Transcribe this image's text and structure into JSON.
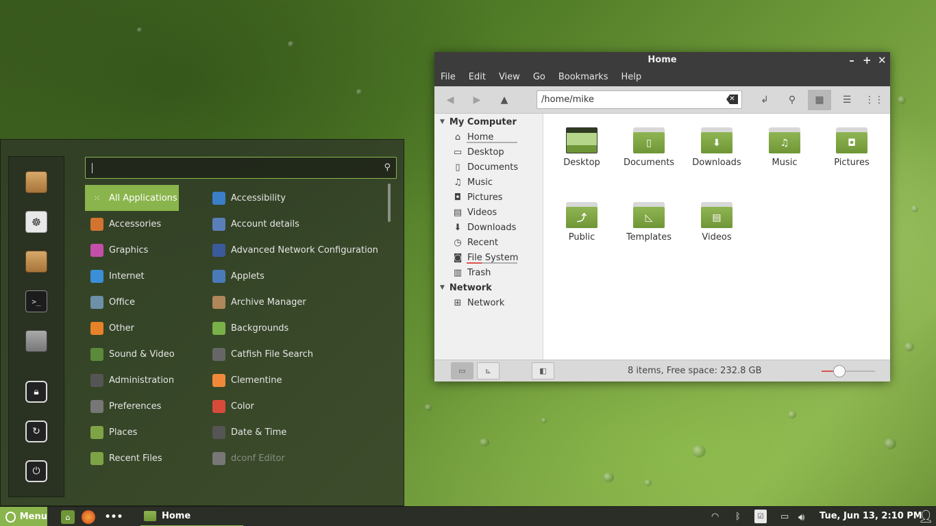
{
  "menu": {
    "categories": [
      {
        "label": "All Applications",
        "icon": "grid-icon",
        "color": "#8ab44c"
      },
      {
        "label": "Accessories",
        "icon": "accessories-icon",
        "color": "#d2742f"
      },
      {
        "label": "Graphics",
        "icon": "graphics-icon",
        "color": "#c44fa8"
      },
      {
        "label": "Internet",
        "icon": "internet-icon",
        "color": "#3a8fd8"
      },
      {
        "label": "Office",
        "icon": "office-icon",
        "color": "#6d8fa8"
      },
      {
        "label": "Other",
        "icon": "other-icon",
        "color": "#e8822a"
      },
      {
        "label": "Sound & Video",
        "icon": "sound-video-icon",
        "color": "#5a8a3a"
      },
      {
        "label": "Administration",
        "icon": "administration-icon",
        "color": "#555555"
      },
      {
        "label": "Preferences",
        "icon": "preferences-icon",
        "color": "#777777"
      },
      {
        "label": "Places",
        "icon": "places-icon",
        "color": "#7ea346"
      },
      {
        "label": "Recent Files",
        "icon": "recent-files-icon",
        "color": "#7ea346"
      }
    ],
    "apps": [
      {
        "label": "Accessibility",
        "icon": "accessibility-icon",
        "color": "#3a7fc8"
      },
      {
        "label": "Account details",
        "icon": "account-details-icon",
        "color": "#5a7fb8"
      },
      {
        "label": "Advanced Network Configuration",
        "icon": "network-config-icon",
        "color": "#3a5a9a"
      },
      {
        "label": "Applets",
        "icon": "applets-icon",
        "color": "#4a7ab8"
      },
      {
        "label": "Archive Manager",
        "icon": "archive-manager-icon",
        "color": "#b0865a"
      },
      {
        "label": "Backgrounds",
        "icon": "backgrounds-icon",
        "color": "#7ab048"
      },
      {
        "label": "Catfish File Search",
        "icon": "catfish-icon",
        "color": "#666666"
      },
      {
        "label": "Clementine",
        "icon": "clementine-icon",
        "color": "#f08a3a"
      },
      {
        "label": "Color",
        "icon": "color-icon",
        "color": "#d84a3a"
      },
      {
        "label": "Date & Time",
        "icon": "date-time-icon",
        "color": "#555555"
      },
      {
        "label": "dconf Editor",
        "icon": "dconf-editor-icon",
        "color": "#777777"
      }
    ],
    "favorites": [
      "package-installer-icon",
      "software-manager-icon",
      "package-manager-icon",
      "terminal-icon",
      "mixer-icon",
      "lock-screen-icon",
      "logout-icon",
      "shutdown-icon"
    ]
  },
  "window": {
    "title": "Home",
    "menubar": [
      "File",
      "Edit",
      "View",
      "Go",
      "Bookmarks",
      "Help"
    ],
    "path": "/home/mike",
    "sidebar": {
      "sections": [
        {
          "title": "My Computer",
          "items": [
            {
              "label": "Home",
              "icon": "home-icon"
            },
            {
              "label": "Desktop",
              "icon": "desktop-icon"
            },
            {
              "label": "Documents",
              "icon": "documents-icon"
            },
            {
              "label": "Music",
              "icon": "music-icon"
            },
            {
              "label": "Pictures",
              "icon": "pictures-icon"
            },
            {
              "label": "Videos",
              "icon": "videos-icon"
            },
            {
              "label": "Downloads",
              "icon": "downloads-icon"
            },
            {
              "label": "Recent",
              "icon": "recent-icon"
            },
            {
              "label": "File System",
              "icon": "filesystem-icon"
            },
            {
              "label": "Trash",
              "icon": "trash-icon"
            }
          ]
        },
        {
          "title": "Network",
          "items": [
            {
              "label": "Network",
              "icon": "network-icon"
            }
          ]
        }
      ]
    },
    "files": [
      {
        "label": "Desktop",
        "icon": "desktop-folder-icon",
        "glyph": ""
      },
      {
        "label": "Documents",
        "icon": "documents-folder-icon",
        "glyph": "▯"
      },
      {
        "label": "Downloads",
        "icon": "downloads-folder-icon",
        "glyph": "⬇"
      },
      {
        "label": "Music",
        "icon": "music-folder-icon",
        "glyph": "♫"
      },
      {
        "label": "Pictures",
        "icon": "pictures-folder-icon",
        "glyph": "◘"
      },
      {
        "label": "Public",
        "icon": "public-folder-icon",
        "glyph": "⤴"
      },
      {
        "label": "Templates",
        "icon": "templates-folder-icon",
        "glyph": "◺"
      },
      {
        "label": "Videos",
        "icon": "videos-folder-icon",
        "glyph": "▤"
      }
    ],
    "status": "8 items, Free space: 232.8 GB"
  },
  "taskbar": {
    "menu_label": "Menu",
    "task_label": "Home",
    "clock": "Tue, Jun 13,  2:10 PM"
  },
  "colors": {
    "accent": "#8ab44c",
    "panel": "#2b2e27"
  }
}
